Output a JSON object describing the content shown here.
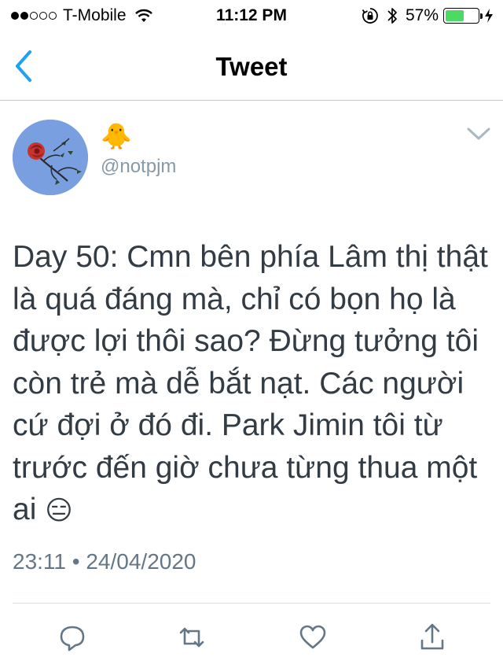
{
  "status_bar": {
    "carrier": "T-Mobile",
    "time": "11:12 PM",
    "battery": "57%",
    "battery_level": 0.57,
    "signal_bars": 2,
    "colors": {
      "battery_fill": "#4cd964"
    }
  },
  "nav": {
    "title": "Tweet",
    "back_icon": "chevron-left-icon",
    "accent": "#1da1f2"
  },
  "tweet": {
    "author": {
      "display_name": "🐥",
      "handle": "@notpjm"
    },
    "text": "Day 50: Cmn bên phía Lâm thị thật là quá đáng mà, chỉ có bọn họ là được lợi thôi sao? Đừng tưởng tôi còn trẻ mà dễ bắt nạt. Các người cứ đợi ở đó đi. Park Jimin tôi từ trước đến giờ chưa từng thua một ai",
    "text_emoji": "😑",
    "timestamp": "23:11 • 24/04/2020"
  },
  "actions": [
    {
      "icon": "reply-icon"
    },
    {
      "icon": "retweet-icon"
    },
    {
      "icon": "like-icon"
    },
    {
      "icon": "share-icon"
    }
  ]
}
